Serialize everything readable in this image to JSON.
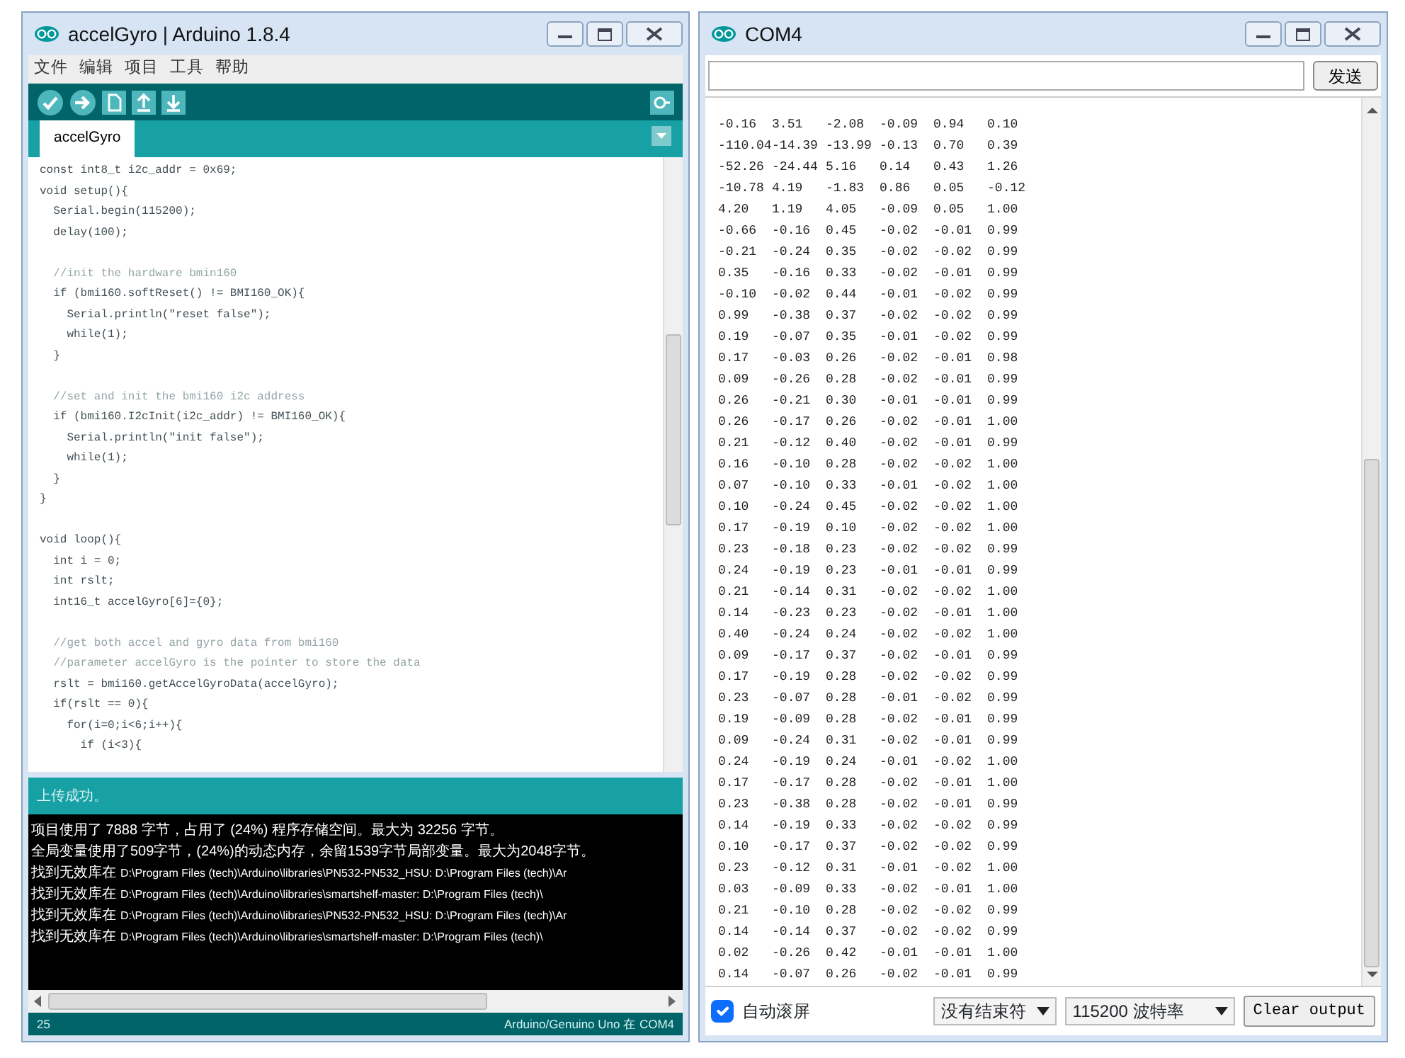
{
  "ide_window": {
    "title": "accelGyro | Arduino 1.8.4",
    "menu": [
      {
        "label": "文件"
      },
      {
        "label": "编辑"
      },
      {
        "label": "项目"
      },
      {
        "label": "工具"
      },
      {
        "label": "帮助"
      }
    ],
    "tabs": [
      {
        "label": "accelGyro",
        "selected": true
      }
    ],
    "code_lines": [
      {
        "kind": "code",
        "text": "const int8_t i2c_addr = 0x69;"
      },
      {
        "kind": "code",
        "text": "void setup(){"
      },
      {
        "kind": "code",
        "text": "  Serial.begin(115200);"
      },
      {
        "kind": "code",
        "text": "  delay(100);"
      },
      {
        "kind": "blank"
      },
      {
        "kind": "comment",
        "text": "  //init the hardware bmin160"
      },
      {
        "kind": "code",
        "text": "  if (bmi160.softReset() != BMI160_OK){"
      },
      {
        "kind": "code",
        "text": "    Serial.println(\"reset false\");"
      },
      {
        "kind": "code",
        "text": "    while(1);"
      },
      {
        "kind": "code",
        "text": "  }"
      },
      {
        "kind": "blank"
      },
      {
        "kind": "comment",
        "text": "  //set and init the bmi160 i2c address"
      },
      {
        "kind": "code",
        "text": "  if (bmi160.I2cInit(i2c_addr) != BMI160_OK){"
      },
      {
        "kind": "code",
        "text": "    Serial.println(\"init false\");"
      },
      {
        "kind": "code",
        "text": "    while(1);"
      },
      {
        "kind": "code",
        "text": "  }"
      },
      {
        "kind": "code",
        "text": "}"
      },
      {
        "kind": "blank"
      },
      {
        "kind": "code",
        "text": "void loop(){"
      },
      {
        "kind": "code",
        "text": "  int i = 0;"
      },
      {
        "kind": "code",
        "text": "  int rslt;"
      },
      {
        "kind": "code",
        "text": "  int16_t accelGyro[6]={0};"
      },
      {
        "kind": "blank"
      },
      {
        "kind": "comment",
        "text": "  //get both accel and gyro data from bmi160"
      },
      {
        "kind": "comment",
        "text": "  //parameter accelGyro is the pointer to store the data"
      },
      {
        "kind": "code",
        "text": "  rslt = bmi160.getAccelGyroData(accelGyro);"
      },
      {
        "kind": "code",
        "text": "  if(rslt == 0){"
      },
      {
        "kind": "code",
        "text": "    for(i=0;i<6;i++){"
      },
      {
        "kind": "code",
        "text": "      if (i<3){"
      }
    ],
    "status_message": "上传成功。",
    "console_lines": [
      {
        "kind": "text",
        "text": "项目使用了 7888 字节，占用了 (24%) 程序存储空间。最大为 32256 字节。"
      },
      {
        "kind": "text",
        "text": "全局变量使用了509字节，(24%)的动态内存，余留1539字节局部变量。最大为2048字节。"
      },
      {
        "kind": "warning",
        "message": "找到无效库在",
        "path": "D:\\Program Files (tech)\\Arduino\\libraries\\PN532-PN532_HSU: D:\\Program Files (tech)\\Ar"
      },
      {
        "kind": "warning",
        "message": "找到无效库在",
        "path": "D:\\Program Files (tech)\\Arduino\\libraries\\smartshelf-master: D:\\Program Files (tech)\\"
      },
      {
        "kind": "warning",
        "message": "找到无效库在",
        "path": "D:\\Program Files (tech)\\Arduino\\libraries\\PN532-PN532_HSU: D:\\Program Files (tech)\\Ar"
      },
      {
        "kind": "warning",
        "message": "找到无效库在",
        "path": "D:\\Program Files (tech)\\Arduino\\libraries\\smartshelf-master: D:\\Program Files (tech)\\"
      }
    ],
    "line_number": "25",
    "board": "Arduino/Genuino Uno 在 COM4"
  },
  "serial_window": {
    "title": "COM4",
    "send_button": "发送",
    "output_rows": [
      [
        "-0.16",
        "3.51",
        "-2.08",
        "-0.09",
        "0.94",
        "0.10"
      ],
      [
        "-110.04",
        "-14.39",
        "-13.99",
        "-0.13",
        "0.70",
        "0.39"
      ],
      [
        "-52.26",
        "-24.44",
        "5.16",
        "0.14",
        "0.43",
        "1.26"
      ],
      [
        "-10.78",
        "4.19",
        "-1.83",
        "0.86",
        "0.05",
        "-0.12"
      ],
      [
        "4.20",
        "1.19",
        "4.05",
        "-0.09",
        "0.05",
        "1.00"
      ],
      [
        "-0.66",
        "-0.16",
        "0.45",
        "-0.02",
        "-0.01",
        "0.99"
      ],
      [
        "-0.21",
        "-0.24",
        "0.35",
        "-0.02",
        "-0.02",
        "0.99"
      ],
      [
        "0.35",
        "-0.16",
        "0.33",
        "-0.02",
        "-0.01",
        "0.99"
      ],
      [
        "-0.10",
        "-0.02",
        "0.44",
        "-0.01",
        "-0.02",
        "0.99"
      ],
      [
        "0.99",
        "-0.38",
        "0.37",
        "-0.02",
        "-0.02",
        "0.99"
      ],
      [
        "0.19",
        "-0.07",
        "0.35",
        "-0.01",
        "-0.02",
        "0.99"
      ],
      [
        "0.17",
        "-0.03",
        "0.26",
        "-0.02",
        "-0.01",
        "0.98"
      ],
      [
        "0.09",
        "-0.26",
        "0.28",
        "-0.02",
        "-0.01",
        "0.99"
      ],
      [
        "0.26",
        "-0.21",
        "0.30",
        "-0.01",
        "-0.01",
        "0.99"
      ],
      [
        "0.26",
        "-0.17",
        "0.26",
        "-0.02",
        "-0.01",
        "1.00"
      ],
      [
        "0.21",
        "-0.12",
        "0.40",
        "-0.02",
        "-0.01",
        "0.99"
      ],
      [
        "0.16",
        "-0.10",
        "0.28",
        "-0.02",
        "-0.02",
        "1.00"
      ],
      [
        "0.07",
        "-0.10",
        "0.33",
        "-0.01",
        "-0.02",
        "1.00"
      ],
      [
        "0.10",
        "-0.24",
        "0.45",
        "-0.02",
        "-0.02",
        "1.00"
      ],
      [
        "0.17",
        "-0.19",
        "0.10",
        "-0.02",
        "-0.02",
        "1.00"
      ],
      [
        "0.23",
        "-0.18",
        "0.23",
        "-0.02",
        "-0.02",
        "0.99"
      ],
      [
        "0.24",
        "-0.19",
        "0.23",
        "-0.01",
        "-0.01",
        "0.99"
      ],
      [
        "0.21",
        "-0.14",
        "0.31",
        "-0.02",
        "-0.02",
        "1.00"
      ],
      [
        "0.14",
        "-0.23",
        "0.23",
        "-0.02",
        "-0.01",
        "1.00"
      ],
      [
        "0.40",
        "-0.24",
        "0.24",
        "-0.02",
        "-0.02",
        "1.00"
      ],
      [
        "0.09",
        "-0.17",
        "0.37",
        "-0.02",
        "-0.01",
        "0.99"
      ],
      [
        "0.17",
        "-0.19",
        "0.28",
        "-0.02",
        "-0.02",
        "0.99"
      ],
      [
        "0.23",
        "-0.07",
        "0.28",
        "-0.01",
        "-0.02",
        "0.99"
      ],
      [
        "0.19",
        "-0.09",
        "0.28",
        "-0.02",
        "-0.01",
        "0.99"
      ],
      [
        "0.09",
        "-0.24",
        "0.31",
        "-0.02",
        "-0.01",
        "0.99"
      ],
      [
        "0.24",
        "-0.19",
        "0.24",
        "-0.01",
        "-0.02",
        "1.00"
      ],
      [
        "0.17",
        "-0.17",
        "0.28",
        "-0.02",
        "-0.01",
        "1.00"
      ],
      [
        "0.23",
        "-0.38",
        "0.28",
        "-0.02",
        "-0.01",
        "0.99"
      ],
      [
        "0.14",
        "-0.19",
        "0.33",
        "-0.02",
        "-0.02",
        "0.99"
      ],
      [
        "0.10",
        "-0.17",
        "0.37",
        "-0.02",
        "-0.02",
        "0.99"
      ],
      [
        "0.23",
        "-0.12",
        "0.31",
        "-0.01",
        "-0.02",
        "1.00"
      ],
      [
        "0.03",
        "-0.09",
        "0.33",
        "-0.02",
        "-0.01",
        "1.00"
      ],
      [
        "0.21",
        "-0.10",
        "0.28",
        "-0.02",
        "-0.02",
        "0.99"
      ],
      [
        "0.14",
        "-0.14",
        "0.37",
        "-0.02",
        "-0.02",
        "0.99"
      ],
      [
        "0.02",
        "-0.26",
        "0.42",
        "-0.01",
        "-0.01",
        "1.00"
      ],
      [
        "0.14",
        "-0.07",
        "0.26",
        "-0.02",
        "-0.01",
        "0.99"
      ]
    ],
    "autoscroll": {
      "label": "自动滚屏",
      "checked": true
    },
    "line_ending": "没有结束符",
    "baud_rate": "115200 波特率",
    "clear_button": "Clear output"
  }
}
